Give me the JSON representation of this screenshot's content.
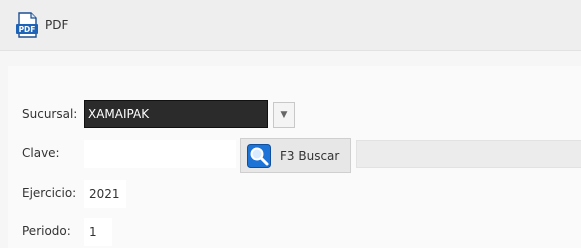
{
  "toolbar": {
    "pdf_label": "PDF",
    "pdf_icon": "pdf-document-icon"
  },
  "form": {
    "sucursal": {
      "label": "Sucursal:",
      "value": "XAMAIPAK",
      "dropdown_icon": "chevron-down-icon"
    },
    "clave": {
      "label": "Clave:",
      "value": "",
      "search_button_label": "F3 Buscar",
      "search_icon": "magnifier-icon",
      "description": ""
    },
    "ejercicio": {
      "label": "Ejercicio:",
      "value": "2021"
    },
    "periodo": {
      "label": "Periodo:",
      "value": "1"
    }
  },
  "colors": {
    "selected_field_bg": "#2b2b2b",
    "search_icon_blue": "#1e73d6",
    "pdf_icon_blue": "#1d4f91"
  }
}
